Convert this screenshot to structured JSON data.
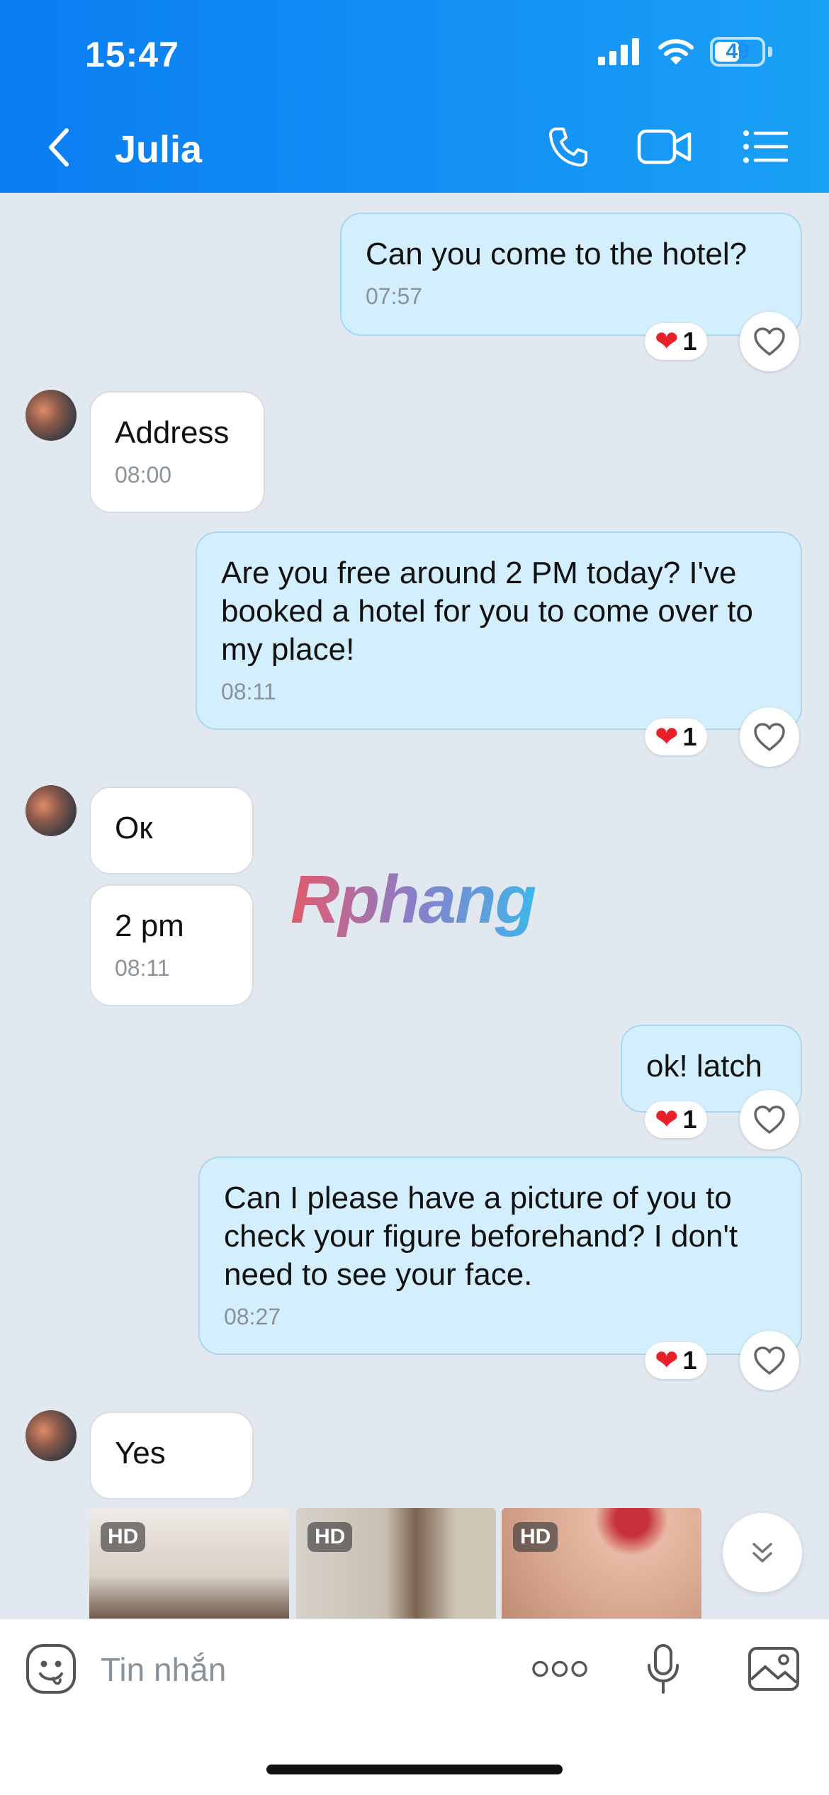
{
  "status_bar": {
    "time": "15:47",
    "battery": "49"
  },
  "header": {
    "contact_name": "Julia"
  },
  "messages": [
    {
      "text": "Can you come to the hotel?",
      "time": "07:57",
      "reaction_count": "1"
    },
    {
      "text": "Address",
      "time": "08:00"
    },
    {
      "text": "Are you free around 2 PM today? I've booked a hotel for you to come over to my place!",
      "time": "08:11",
      "reaction_count": "1"
    },
    {
      "text": "Ок"
    },
    {
      "text": "2 pm",
      "time": "08:11"
    },
    {
      "text": "ok! latch",
      "reaction_count": "1"
    },
    {
      "text": "Can I please have a picture of you to check your figure beforehand? I don't need to see your face.",
      "time": "08:27",
      "reaction_count": "1"
    },
    {
      "text": "Yes"
    }
  ],
  "photos": [
    {
      "badge": "HD"
    },
    {
      "badge": "HD"
    },
    {
      "badge": "HD"
    }
  ],
  "watermark": "Rphang",
  "input": {
    "placeholder": "Tin nhắn"
  },
  "colors": {
    "header": "#0a7df2",
    "outgoing_bubble": "#d3eefc",
    "incoming_bubble": "#ffffff",
    "reaction_heart": "#e8202a"
  },
  "icons": [
    "back-icon",
    "phone-icon",
    "video-call-icon",
    "menu-list-icon",
    "heart-icon",
    "chevron-down-icon",
    "sticker-icon",
    "more-icon",
    "microphone-icon",
    "image-icon"
  ]
}
